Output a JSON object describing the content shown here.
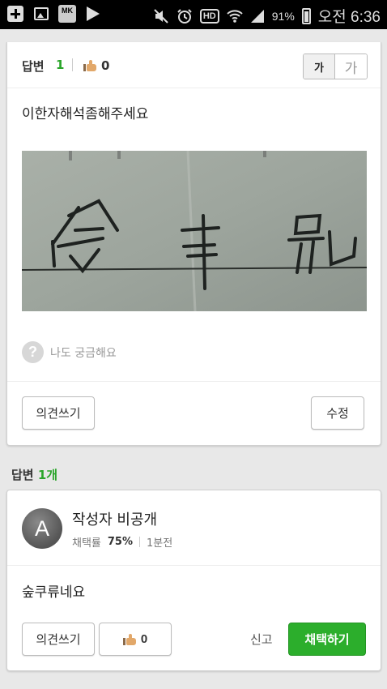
{
  "status_bar": {
    "battery_percent": "91%",
    "clock": "오전 6:36",
    "hd_label": "HD",
    "mk_badge": "MK",
    "icons": [
      "add-icon",
      "image-icon",
      "mk-app-icon",
      "play-icon",
      "mute-icon",
      "alarm-icon",
      "hd-voice-icon",
      "wifi-icon",
      "signal-icon",
      "battery-icon"
    ]
  },
  "question": {
    "answer_label": "답변",
    "answer_count": "1",
    "like_count": "0",
    "font_small": "가",
    "font_large": "가",
    "text": "이한자해석좀해주세요",
    "curious_label": "나도 궁금해요",
    "opinion_button": "의견쓰기",
    "edit_button": "수정"
  },
  "answers_section": {
    "title_prefix": "답변 ",
    "count": "1개"
  },
  "answer": {
    "avatar_letter": "A",
    "author": "작성자 비공개",
    "adoption_label": "채택률",
    "adoption_rate": "75%",
    "time_ago": "1분전",
    "text": "숲쿠류네요",
    "opinion_button": "의견쓰기",
    "like_count": "0",
    "report_label": "신고",
    "adopt_button": "채택하기"
  },
  "colors": {
    "accent_green": "#2cae2c",
    "count_green": "#2aa52a"
  }
}
